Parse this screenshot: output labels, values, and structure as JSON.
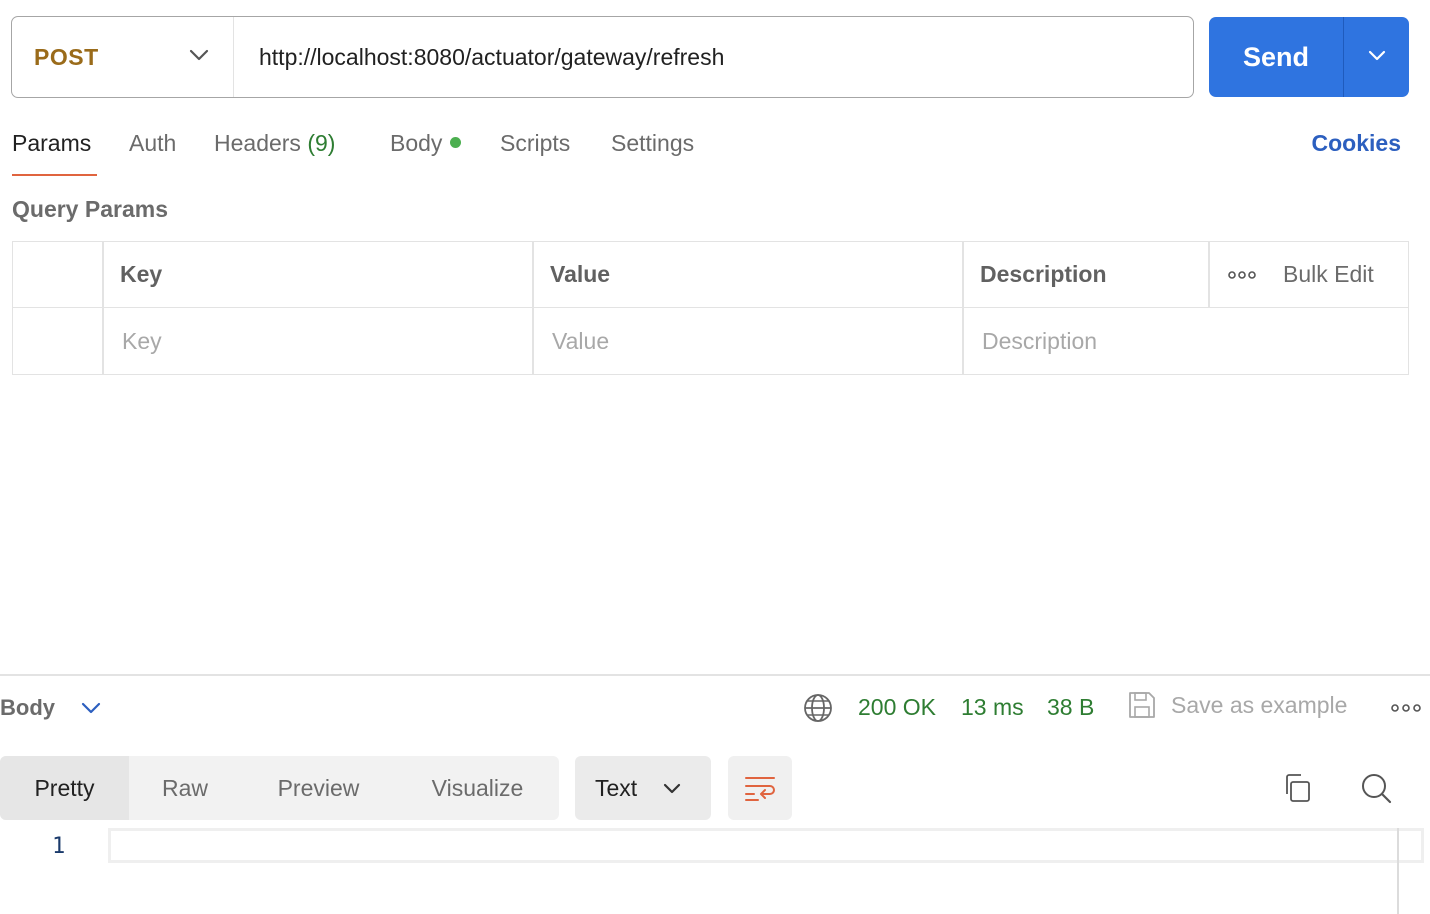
{
  "request": {
    "method": "POST",
    "url": "http://localhost:8080/actuator/gateway/refresh",
    "send_label": "Send"
  },
  "tabs": {
    "params": "Params",
    "auth": "Auth",
    "headers": "Headers",
    "headers_count": "(9)",
    "body": "Body",
    "scripts": "Scripts",
    "settings": "Settings",
    "cookies": "Cookies"
  },
  "query_params": {
    "title": "Query Params",
    "columns": {
      "key": "Key",
      "value": "Value",
      "description": "Description"
    },
    "bulk_edit": "Bulk Edit",
    "placeholders": {
      "key": "Key",
      "value": "Value",
      "description": "Description"
    }
  },
  "response": {
    "section_label": "Body",
    "status": "200 OK",
    "time": "13 ms",
    "size": "38 B",
    "save_example": "Save as example",
    "view_tabs": [
      "Pretty",
      "Raw",
      "Preview",
      "Visualize"
    ],
    "format": "Text",
    "line_number": "1"
  },
  "colors": {
    "method": "#9a6b1a",
    "send": "#2f74e0",
    "active_tab_underline": "#e0643f",
    "status_green": "#2e7d32",
    "link_blue": "#2c5fbf"
  }
}
